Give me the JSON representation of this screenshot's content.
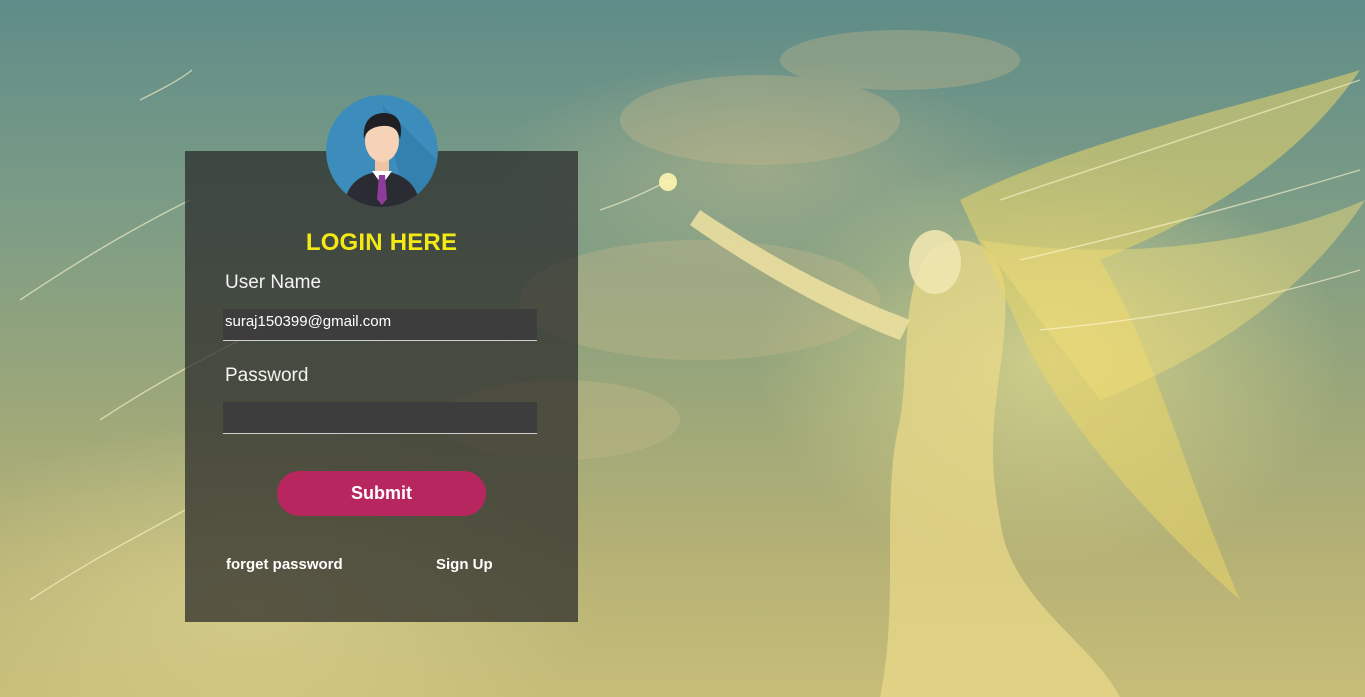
{
  "login": {
    "title": "LOGIN HERE",
    "username_label": "User Name",
    "username_value": "suraj150399@gmail.com",
    "password_label": "Password",
    "password_value": "",
    "submit_label": "Submit",
    "forget_password_label": "forget password",
    "signup_label": "Sign Up"
  },
  "colors": {
    "title": "#f2e915",
    "submit_button": "#b8265f",
    "box_background": "rgba(40,40,40,0.72)",
    "input_background": "#3d3d3d"
  },
  "icons": {
    "avatar": "user-avatar-icon"
  }
}
